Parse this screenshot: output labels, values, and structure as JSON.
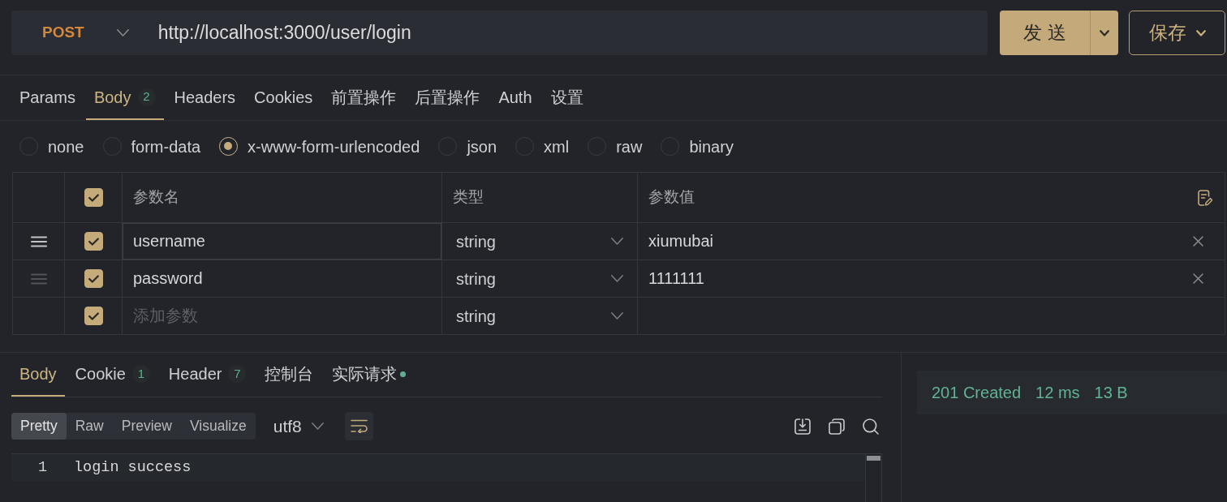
{
  "request": {
    "method": "POST",
    "url": "http://localhost:3000/user/login"
  },
  "actions": {
    "send": "发 送",
    "save": "保存"
  },
  "request_tabs": [
    {
      "label": "Params",
      "selected": false
    },
    {
      "label": "Body",
      "count": "2",
      "selected": true
    },
    {
      "label": "Headers",
      "selected": false
    },
    {
      "label": "Cookies",
      "selected": false
    },
    {
      "label": "前置操作",
      "selected": false
    },
    {
      "label": "后置操作",
      "selected": false
    },
    {
      "label": "Auth",
      "selected": false
    },
    {
      "label": "设置",
      "selected": false
    }
  ],
  "body_types": [
    {
      "label": "none",
      "selected": false
    },
    {
      "label": "form-data",
      "selected": false
    },
    {
      "label": "x-www-form-urlencoded",
      "selected": true
    },
    {
      "label": "json",
      "selected": false
    },
    {
      "label": "xml",
      "selected": false
    },
    {
      "label": "raw",
      "selected": false
    },
    {
      "label": "binary",
      "selected": false
    }
  ],
  "params_table": {
    "columns": [
      "参数名",
      "类型",
      "参数值"
    ],
    "all_checked": true,
    "rows": [
      {
        "kind": "param",
        "name": "username",
        "type": "string",
        "value": "xiumubai",
        "checked": true,
        "hovered": true
      },
      {
        "kind": "param",
        "name": "password",
        "type": "string",
        "value": "1111111",
        "checked": true,
        "hovered": false
      },
      {
        "kind": "new",
        "placeholder": "添加参数",
        "type": "string",
        "checked": true,
        "hovered": false
      }
    ]
  },
  "response_tabs": [
    {
      "label": "Body",
      "selected": true,
      "indicator": false
    },
    {
      "label": "Cookie",
      "count": "1",
      "selected": false,
      "indicator": false
    },
    {
      "label": "Header",
      "count": "7",
      "selected": false,
      "indicator": false
    },
    {
      "label": "控制台",
      "selected": false,
      "indicator": false
    },
    {
      "label": "实际请求",
      "selected": false,
      "indicator": true
    }
  ],
  "view_modes": [
    {
      "label": "Pretty",
      "selected": true
    },
    {
      "label": "Raw",
      "selected": false
    },
    {
      "label": "Preview",
      "selected": false
    },
    {
      "label": "Visualize",
      "selected": false
    }
  ],
  "encoding": "utf8",
  "word_wrap": true,
  "editor": {
    "lines": [
      {
        "number": "1",
        "text": "login success"
      }
    ]
  },
  "status": {
    "code": "201 Created",
    "time": "12 ms",
    "size": "13 B"
  }
}
